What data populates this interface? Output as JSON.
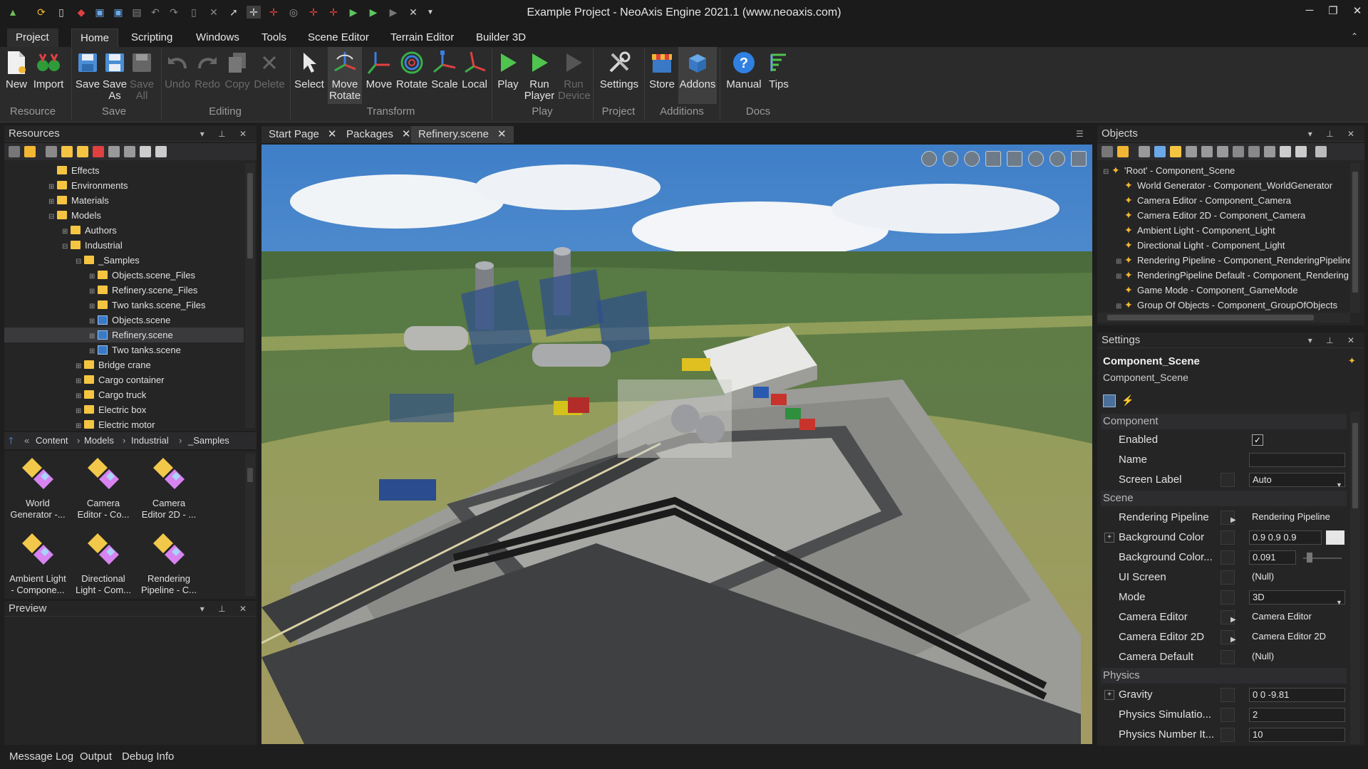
{
  "window": {
    "title": "Example Project - NeoAxis Engine 2021.1 (www.neoaxis.com)"
  },
  "menu_tabs": [
    "Project",
    "Home",
    "Scripting",
    "Windows",
    "Tools",
    "Scene Editor",
    "Terrain Editor",
    "Builder 3D"
  ],
  "ribbon": {
    "buttons": {
      "new": "New",
      "import": "Import",
      "save": "Save",
      "save_as": "Save As",
      "save_all": "Save All",
      "undo": "Undo",
      "redo": "Redo",
      "copy": "Copy",
      "delete": "Delete",
      "select": "Select",
      "move_rotate": "Move Rotate",
      "move": "Move",
      "rotate": "Rotate",
      "scale": "Scale",
      "local": "Local",
      "play": "Play",
      "run_player": "Run Player",
      "run_device": "Run Device",
      "settings": "Settings",
      "store": "Store",
      "addons": "Addons",
      "manual": "Manual",
      "tips": "Tips"
    },
    "groups": {
      "resource": "Resource",
      "save": "Save",
      "editing": "Editing",
      "transform": "Transform",
      "play": "Play",
      "project": "Project",
      "additions": "Additions",
      "docs": "Docs"
    }
  },
  "resources": {
    "title": "Resources",
    "tree": [
      {
        "label": "Effects",
        "type": "folder"
      },
      {
        "label": "Environments",
        "type": "folder"
      },
      {
        "label": "Materials",
        "type": "folder"
      },
      {
        "label": "Models",
        "type": "folder"
      },
      {
        "label": "Authors",
        "type": "folder"
      },
      {
        "label": "Industrial",
        "type": "folder"
      },
      {
        "label": "_Samples",
        "type": "folder"
      },
      {
        "label": "Objects.scene_Files",
        "type": "folder"
      },
      {
        "label": "Refinery.scene_Files",
        "type": "folder"
      },
      {
        "label": "Two tanks.scene_Files",
        "type": "folder"
      },
      {
        "label": "Objects.scene",
        "type": "scene"
      },
      {
        "label": "Refinery.scene",
        "type": "scene"
      },
      {
        "label": "Two tanks.scene",
        "type": "scene"
      },
      {
        "label": "Bridge crane",
        "type": "folder"
      },
      {
        "label": "Cargo container",
        "type": "folder"
      },
      {
        "label": "Cargo truck",
        "type": "folder"
      },
      {
        "label": "Electric box",
        "type": "folder"
      },
      {
        "label": "Electric motor",
        "type": "folder"
      }
    ],
    "breadcrumb": [
      "Content",
      "Models",
      "Industrial",
      "_Samples"
    ],
    "components": [
      {
        "line1": "World",
        "line2": "Generator -..."
      },
      {
        "line1": "Camera",
        "line2": "Editor - Co..."
      },
      {
        "line1": "Camera",
        "line2": "Editor 2D - ..."
      },
      {
        "line1": "Ambient Light",
        "line2": "- Compone..."
      },
      {
        "line1": "Directional",
        "line2": "Light - Com..."
      },
      {
        "line1": "Rendering",
        "line2": "Pipeline - C..."
      }
    ]
  },
  "preview": {
    "title": "Preview"
  },
  "doc_tabs": [
    "Start Page",
    "Packages",
    "Refinery.scene"
  ],
  "objects": {
    "title": "Objects",
    "tree": [
      "'Root' - Component_Scene",
      "World Generator - Component_WorldGenerator",
      "Camera Editor - Component_Camera",
      "Camera Editor 2D - Component_Camera",
      "Ambient Light - Component_Light",
      "Directional Light - Component_Light",
      "Rendering Pipeline - Component_RenderingPipeline",
      "RenderingPipeline Default - Component_Rendering",
      "Game Mode - Component_GameMode",
      "Group Of Objects - Component_GroupOfObjects"
    ]
  },
  "settings": {
    "title": "Settings",
    "header_bold": "Component_Scene",
    "header_sub": "Component_Scene",
    "categories": {
      "component": "Component",
      "scene": "Scene",
      "physics": "Physics"
    },
    "props": {
      "enabled": {
        "name": "Enabled",
        "checked": true
      },
      "name": {
        "name": "Name",
        "value": ""
      },
      "screen_label": {
        "name": "Screen Label",
        "value": "Auto"
      },
      "rendering_pipeline": {
        "name": "Rendering Pipeline",
        "value": "Rendering Pipeline"
      },
      "background_color": {
        "name": "Background Color",
        "value": "0.9 0.9 0.9"
      },
      "background_color_mult": {
        "name": "Background Color...",
        "value": "0.091"
      },
      "ui_screen": {
        "name": "UI Screen",
        "value": "(Null)"
      },
      "mode": {
        "name": "Mode",
        "value": "3D"
      },
      "camera_editor": {
        "name": "Camera Editor",
        "value": "Camera Editor"
      },
      "camera_editor_2d": {
        "name": "Camera Editor 2D",
        "value": "Camera Editor 2D"
      },
      "camera_default": {
        "name": "Camera Default",
        "value": "(Null)"
      },
      "gravity": {
        "name": "Gravity",
        "value": "0 0 -9.81"
      },
      "physics_simulation": {
        "name": "Physics Simulatio...",
        "value": "2"
      },
      "physics_number": {
        "name": "Physics Number It...",
        "value": "10"
      }
    }
  },
  "bottom_tabs": [
    "Message Log",
    "Output",
    "Debug Info"
  ],
  "colors": {
    "accent": "#f5c542",
    "bg": "#1e1e1e",
    "panel": "#252526"
  }
}
